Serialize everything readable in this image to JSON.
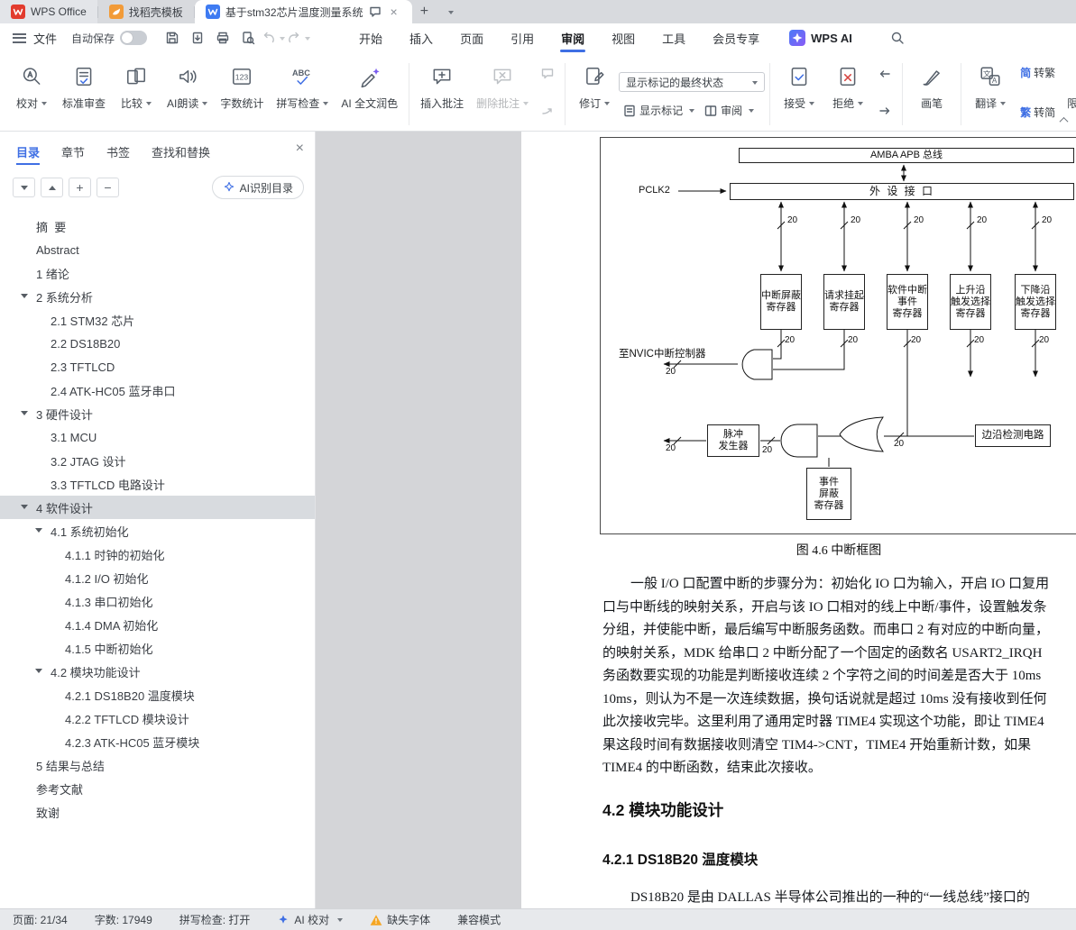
{
  "colors": {
    "accent_blue": "#3f6fe4",
    "wps_red": "#e23b2e",
    "docer_orange": "#f29b38",
    "doc_blue": "#3e7bf2",
    "warning_orange": "#f5a623"
  },
  "icons": {
    "close": "×",
    "plus": "+",
    "minus": "−",
    "new_tab": "+",
    "count": "123",
    "abc": "ABC",
    "cn": "文",
    "a": "A"
  },
  "tabbar": {
    "home": "WPS Office",
    "docer": "找稻壳模板",
    "doc": "基于stm32芯片温度测量系统"
  },
  "menubar": {
    "file": "文件",
    "autosave": "自动保存",
    "tabs": [
      {
        "label": "开始"
      },
      {
        "label": "插入"
      },
      {
        "label": "页面"
      },
      {
        "label": "引用"
      },
      {
        "label": "审阅"
      },
      {
        "label": "视图"
      },
      {
        "label": "工具"
      },
      {
        "label": "会员专享"
      }
    ],
    "wps_ai": "WPS AI"
  },
  "ribbon": {
    "proofread": "校对",
    "standard_review": "标准审查",
    "compare": "比较",
    "ai_read": "AI朗读",
    "word_count": "字数统计",
    "spell_check": "拼写检查",
    "ai_polish": "AI 全文润色",
    "insert_comment": "插入批注",
    "delete_comment": "删除批注",
    "markup_state": "显示标记的最终状态",
    "track_changes": "修订",
    "show_markup": "显示标记",
    "review_pane": "审阅",
    "accept": "接受",
    "reject": "拒绝",
    "brush": "画笔",
    "translate": "翻译",
    "s2t_icon": "简",
    "s2t": "转繁",
    "t2s_icon": "繁",
    "t2s": "转简",
    "restrict": "限制编辑"
  },
  "sidebar": {
    "tabs": [
      {
        "label": "目录"
      },
      {
        "label": "章节"
      },
      {
        "label": "书签"
      },
      {
        "label": "查找和替换"
      }
    ],
    "ai_toc_button": "AI识别目录",
    "toc": [
      {
        "label": "摘  要",
        "level": 0
      },
      {
        "label": "Abstract",
        "level": 0
      },
      {
        "label": "1 绪论",
        "level": 0
      },
      {
        "label": "2 系统分析",
        "level": 0,
        "expanded": true
      },
      {
        "label": "2.1 STM32 芯片",
        "level": 1
      },
      {
        "label": "2.2 DS18B20",
        "level": 1
      },
      {
        "label": "2.3 TFTLCD",
        "level": 1
      },
      {
        "label": "2.4 ATK-HC05 蓝牙串口",
        "level": 1
      },
      {
        "label": "3 硬件设计",
        "level": 0,
        "expanded": true
      },
      {
        "label": "3.1 MCU",
        "level": 1
      },
      {
        "label": "3.2 JTAG 设计",
        "level": 1
      },
      {
        "label": "3.3 TFTLCD 电路设计",
        "level": 1
      },
      {
        "label": "4 软件设计",
        "level": 0,
        "expanded": true,
        "selected": true
      },
      {
        "label": "4.1 系统初始化",
        "level": 1,
        "expanded": true
      },
      {
        "label": "4.1.1 时钟的初始化",
        "level": 2
      },
      {
        "label": "4.1.2 I/O 初始化",
        "level": 2
      },
      {
        "label": "4.1.3 串口初始化",
        "level": 2
      },
      {
        "label": "4.1.4 DMA 初始化",
        "level": 2
      },
      {
        "label": "4.1.5 中断初始化",
        "level": 2
      },
      {
        "label": "4.2 模块功能设计",
        "level": 1,
        "expanded": true
      },
      {
        "label": "4.2.1 DS18B20 温度模块",
        "level": 2
      },
      {
        "label": "4.2.2 TFTLCD 模块设计",
        "level": 2
      },
      {
        "label": "4.2.3 ATK-HC05 蓝牙模块",
        "level": 2
      },
      {
        "label": "5 结果与总结",
        "level": 0
      },
      {
        "label": "参考文献",
        "level": 0
      },
      {
        "label": "致谢",
        "level": 0
      }
    ]
  },
  "document": {
    "figure": {
      "caption": "图 4.6 中断框图",
      "bus": "AMBA APB 总线",
      "pclk": "PCLK2",
      "peripheral": "外 设 接 口",
      "reg_mask": "中断屏蔽\n寄存器",
      "reg_pending": "请求挂起\n寄存器",
      "reg_swier": "软件中断\n事件\n寄存器",
      "reg_rising": "上升沿\n触发选择\n寄存器",
      "reg_falling": "下降沿\n触发选择\n寄存器",
      "to_nvic": "至NVIC中断控制器",
      "pulse": "脉冲\n发生器",
      "event_mask": "事件\n屏蔽\n寄存器",
      "edge_detect": "边沿检测电路",
      "bus_width": "20"
    },
    "paragraph1_lines": [
      "一般 I/O 口配置中断的步骤分为：初始化 IO 口为输入，开启 IO 口复用",
      "口与中断线的映射关系，开启与该 IO 口相对的线上中断/事件，设置触发条",
      "分组，并使能中断，最后编写中断服务函数。而串口 2 有对应的中断向量，",
      "的映射关系，MDK 给串口 2 中断分配了一个固定的函数名 USART2_IRQH",
      "务函数要实现的功能是判断接收连续 2 个字符之间的时间差是否大于 10ms",
      "10ms，则认为不是一次连续数据，换句话说就是超过 10ms 没有接收到任何",
      "此次接收完毕。这里利用了通用定时器 TIME4 实现这个功能，即让 TIME4",
      "果这段时间有数据接收则清空 TIM4->CNT，TIME4 开始重新计数，如果",
      "TIME4 的中断函数，结束此次接收。"
    ],
    "heading_42": "4.2 模块功能设计",
    "heading_421": "4.2.1 DS18B20 温度模块",
    "paragraph2": "DS18B20 是由 DALLAS 半导体公司推出的一种的“一线总线”接口的"
  },
  "statusbar": {
    "page": "页面: 21/34",
    "words": "字数: 17949",
    "spell": "拼写检查: 打开",
    "ai_proof": "AI 校对",
    "missing_font": "缺失字体",
    "compat_mode": "兼容模式"
  }
}
